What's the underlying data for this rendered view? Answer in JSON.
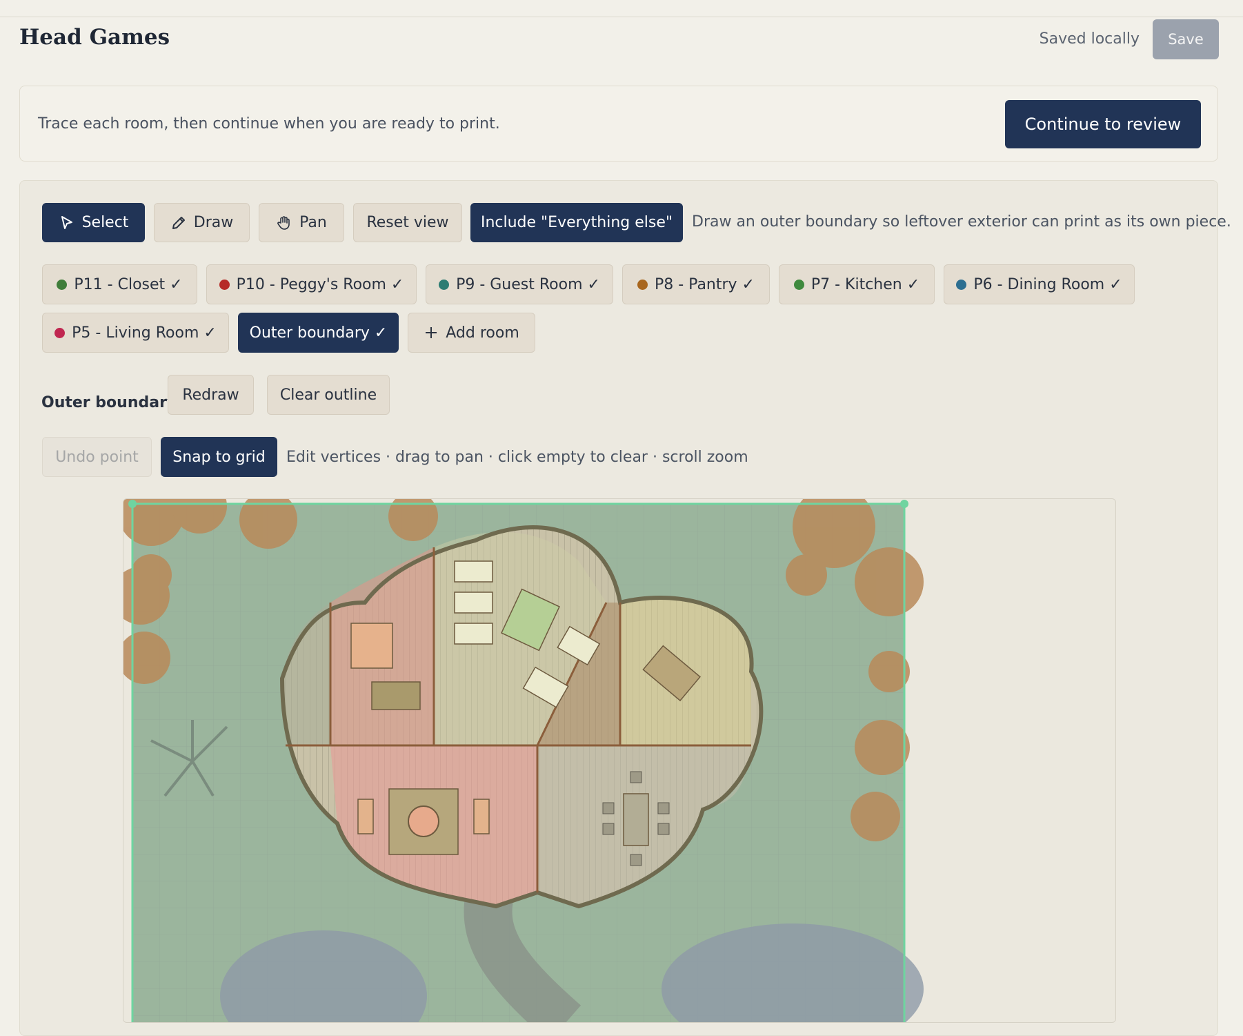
{
  "header": {
    "title": "Head Games",
    "saved_status": "Saved locally",
    "save_label": "Save"
  },
  "banner": {
    "message": "Trace each room, then continue when you are ready to print.",
    "continue_label": "Continue to review"
  },
  "toolbar": {
    "select_label": "Select",
    "draw_label": "Draw",
    "pan_label": "Pan",
    "reset_label": "Reset view",
    "include_label": "Include \"Everything else\"",
    "include_hint": "Draw an outer boundary so leftover exterior can print as its own piece."
  },
  "rooms": [
    {
      "label": "P11 - Closet ✓",
      "color": "#3f7d3a"
    },
    {
      "label": "P10 - Peggy's Room ✓",
      "color": "#b62a26"
    },
    {
      "label": "P9 - Guest Room ✓",
      "color": "#2c7c72"
    },
    {
      "label": "P8 - Pantry ✓",
      "color": "#a8661e"
    },
    {
      "label": "P7 - Kitchen ✓",
      "color": "#3f8a3e"
    },
    {
      "label": "P6 - Dining Room ✓",
      "color": "#2d6f91"
    },
    {
      "label": "P5 - Living Room ✓",
      "color": "#c02650"
    }
  ],
  "outer_boundary_chip": "Outer boundary ✓",
  "add_room_label": "Add room",
  "outline_tools": {
    "section_label": "Outer boundary",
    "redraw_label": "Redraw",
    "clear_label": "Clear outline"
  },
  "edit_tools": {
    "undo_label": "Undo point",
    "snap_label": "Snap to grid",
    "hint": "Edit vertices · drag to pan · click empty to clear · scroll zoom"
  },
  "map": {
    "accent_color": "#6fd4a0"
  }
}
